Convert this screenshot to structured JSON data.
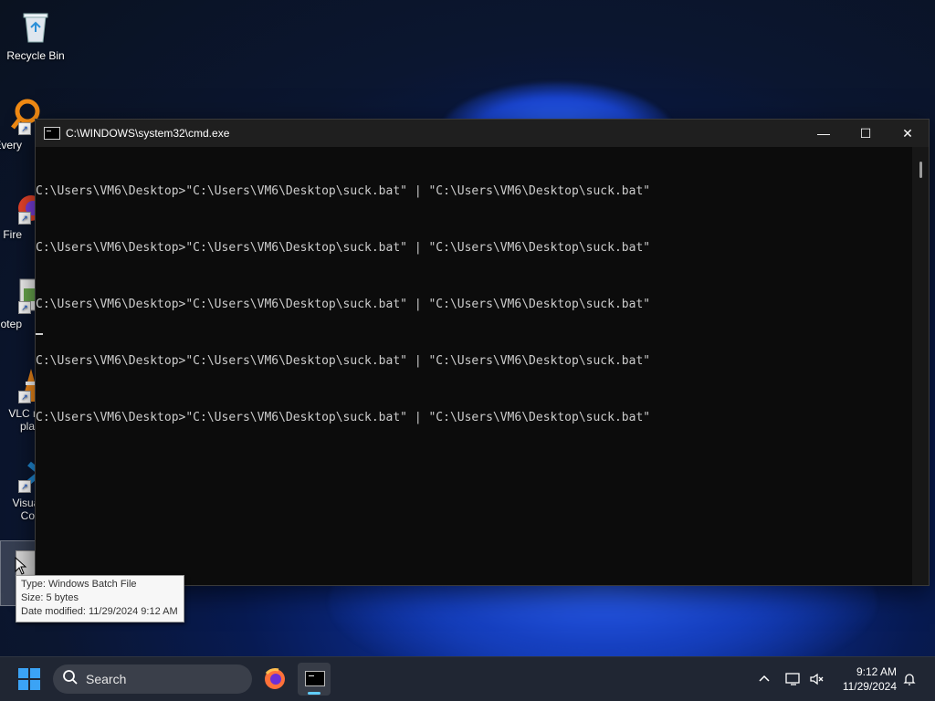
{
  "desktop": {
    "icons": [
      {
        "label": "Recycle Bin",
        "icon": "recycle-bin-icon"
      },
      {
        "label": "Every",
        "icon": "everything-search-icon"
      },
      {
        "label": "Fire",
        "icon": "firefox-icon"
      },
      {
        "label": "Notep",
        "icon": "notepad-icon"
      },
      {
        "label": "VLC m",
        "label2": "pla",
        "icon": "vlc-icon"
      },
      {
        "label": "Visual",
        "label2": "Co",
        "icon": "vscode-icon"
      },
      {
        "label": "",
        "icon": "batch-file-icon"
      }
    ]
  },
  "cmd_window": {
    "title": "C:\\WINDOWS\\system32\\cmd.exe",
    "lines": [
      "C:\\Users\\VM6\\Desktop>\"C:\\Users\\VM6\\Desktop\\suck.bat\" | \"C:\\Users\\VM6\\Desktop\\suck.bat\"",
      "C:\\Users\\VM6\\Desktop>\"C:\\Users\\VM6\\Desktop\\suck.bat\" | \"C:\\Users\\VM6\\Desktop\\suck.bat\"",
      "C:\\Users\\VM6\\Desktop>\"C:\\Users\\VM6\\Desktop\\suck.bat\" | \"C:\\Users\\VM6\\Desktop\\suck.bat\"",
      "C:\\Users\\VM6\\Desktop>\"C:\\Users\\VM6\\Desktop\\suck.bat\" | \"C:\\Users\\VM6\\Desktop\\suck.bat\"",
      "C:\\Users\\VM6\\Desktop>\"C:\\Users\\VM6\\Desktop\\suck.bat\" | \"C:\\Users\\VM6\\Desktop\\suck.bat\""
    ],
    "minimize_glyph": "—",
    "maximize_glyph": "☐",
    "close_glyph": "✕"
  },
  "tooltip": {
    "type": "Type: Windows Batch File",
    "size": "Size: 5 bytes",
    "modified": "Date modified: 11/29/2024 9:12 AM"
  },
  "taskbar": {
    "search_label": "Search",
    "time": "9:12 AM",
    "date": "11/29/2024",
    "tray_chevron": "^"
  },
  "colors": {
    "accent": "#3ba3f5",
    "terminal_bg": "#0c0c0c",
    "terminal_text": "#cccccc",
    "taskbar_bg": "#202633"
  }
}
